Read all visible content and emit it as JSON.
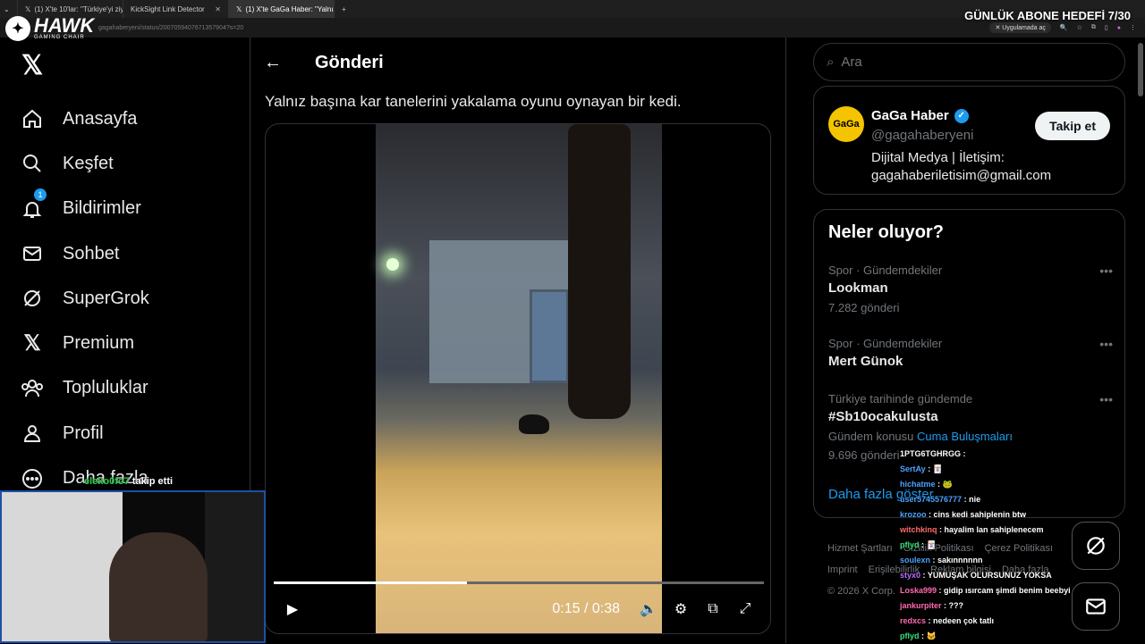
{
  "browser": {
    "tabs": [
      {
        "title": "(1) X'te 10'lar: \"Türkiye'yi ziyare…",
        "active": false
      },
      {
        "title": "KickSight Link Detector",
        "active": false
      },
      {
        "title": "(1) X'te GaGa Haber: \"Yalnız baş…",
        "active": true
      }
    ],
    "url": "gagahaberyeni/status/2007059407671357904?s=20",
    "open_in_app": "Uygulamada aç"
  },
  "overlay": {
    "goal": "GÜNLÜK ABONE HEDEFİ 7/30",
    "brand": "HAWK",
    "brand_sub": "GAMING CHAIR",
    "follow_user": "eleko0fo7",
    "follow_text": "takip etti"
  },
  "nav": {
    "items": [
      {
        "label": "Anasayfa",
        "icon": "home-icon"
      },
      {
        "label": "Keşfet",
        "icon": "search-icon"
      },
      {
        "label": "Bildirimler",
        "icon": "bell-icon",
        "badge": "1"
      },
      {
        "label": "Sohbet",
        "icon": "mail-icon"
      },
      {
        "label": "SuperGrok",
        "icon": "grok-icon"
      },
      {
        "label": "Premium",
        "icon": "x-icon"
      },
      {
        "label": "Topluluklar",
        "icon": "people-icon"
      },
      {
        "label": "Profil",
        "icon": "person-icon"
      },
      {
        "label": "Daha fazla",
        "icon": "more-icon"
      }
    ]
  },
  "post": {
    "header": "Gönderi",
    "text": "Yalnız başına kar tanelerini yakalama oyunu oynayan bir kedi.",
    "video": {
      "current": "0:15",
      "duration": "0:38",
      "progress": 0.395
    }
  },
  "right": {
    "search_placeholder": "Ara",
    "profile": {
      "avatar_text": "GaGa",
      "name": "GaGa Haber",
      "handle": "@gagahaberyeni",
      "bio": "Dijital Medya | İletişim: gagahaberiletisim@gmail.com",
      "follow_label": "Takip et"
    },
    "trends_title": "Neler oluyor?",
    "trends": [
      {
        "meta": "Spor · Gündemdekiler",
        "name": "Lookman",
        "count": "7.282 gönderi"
      },
      {
        "meta": "Spor · Gündemdekiler",
        "name": "Mert Günok",
        "count": ""
      },
      {
        "meta": "Türkiye tarihinde gündemde",
        "name": "#Sb10ocakulusta",
        "count": "Gündem konusu",
        "link": "Cuma Buluşmaları",
        "count2": "9.696 gönderi"
      }
    ],
    "show_more": "Daha fazla göster",
    "footer": [
      "Hizmet Şartları",
      "Gizlilik Politikası",
      "Çerez Politikası",
      "Imprint",
      "Erişilebilirlik",
      "Reklam bilgisi",
      "Daha fazla",
      "© 2026 X Corp."
    ]
  },
  "chat": [
    {
      "user": "1PTG6TGHRGG",
      "msg": "",
      "color": "#ffffff"
    },
    {
      "user": "SertAy",
      "msg": "🃏",
      "color": "#4aa3ff"
    },
    {
      "user": "hichatme",
      "msg": "🐸",
      "color": "#4aa3ff"
    },
    {
      "user": "user5745576777",
      "msg": "nie",
      "color": "#4aa3ff"
    },
    {
      "user": "krozoo",
      "msg": "cins kedi sahiplenin btw",
      "color": "#4aa3ff"
    },
    {
      "user": "witchkinq",
      "msg": "hayalim lan sahiplenecem",
      "color": "#ff6a6a"
    },
    {
      "user": "pflyd",
      "msg": "🃏",
      "color": "#39e07a"
    },
    {
      "user": "soulexn",
      "msg": "sakınnnnnn",
      "color": "#4aa3ff"
    },
    {
      "user": "styx0",
      "msg": "YUMUŞAK OLURSUNUZ YOKSA",
      "color": "#c06aff"
    },
    {
      "user": "Loska999",
      "msg": "gidip ısırcam şimdi benim beebyi",
      "color": "#ff6ab0"
    },
    {
      "user": "jankurpiter",
      "msg": "???",
      "color": "#ff6ab0"
    },
    {
      "user": "redxcs",
      "msg": "nedeen çok tatlı",
      "color": "#ff6ab0"
    },
    {
      "user": "pflyd",
      "msg": "🐱",
      "color": "#39e07a"
    }
  ]
}
